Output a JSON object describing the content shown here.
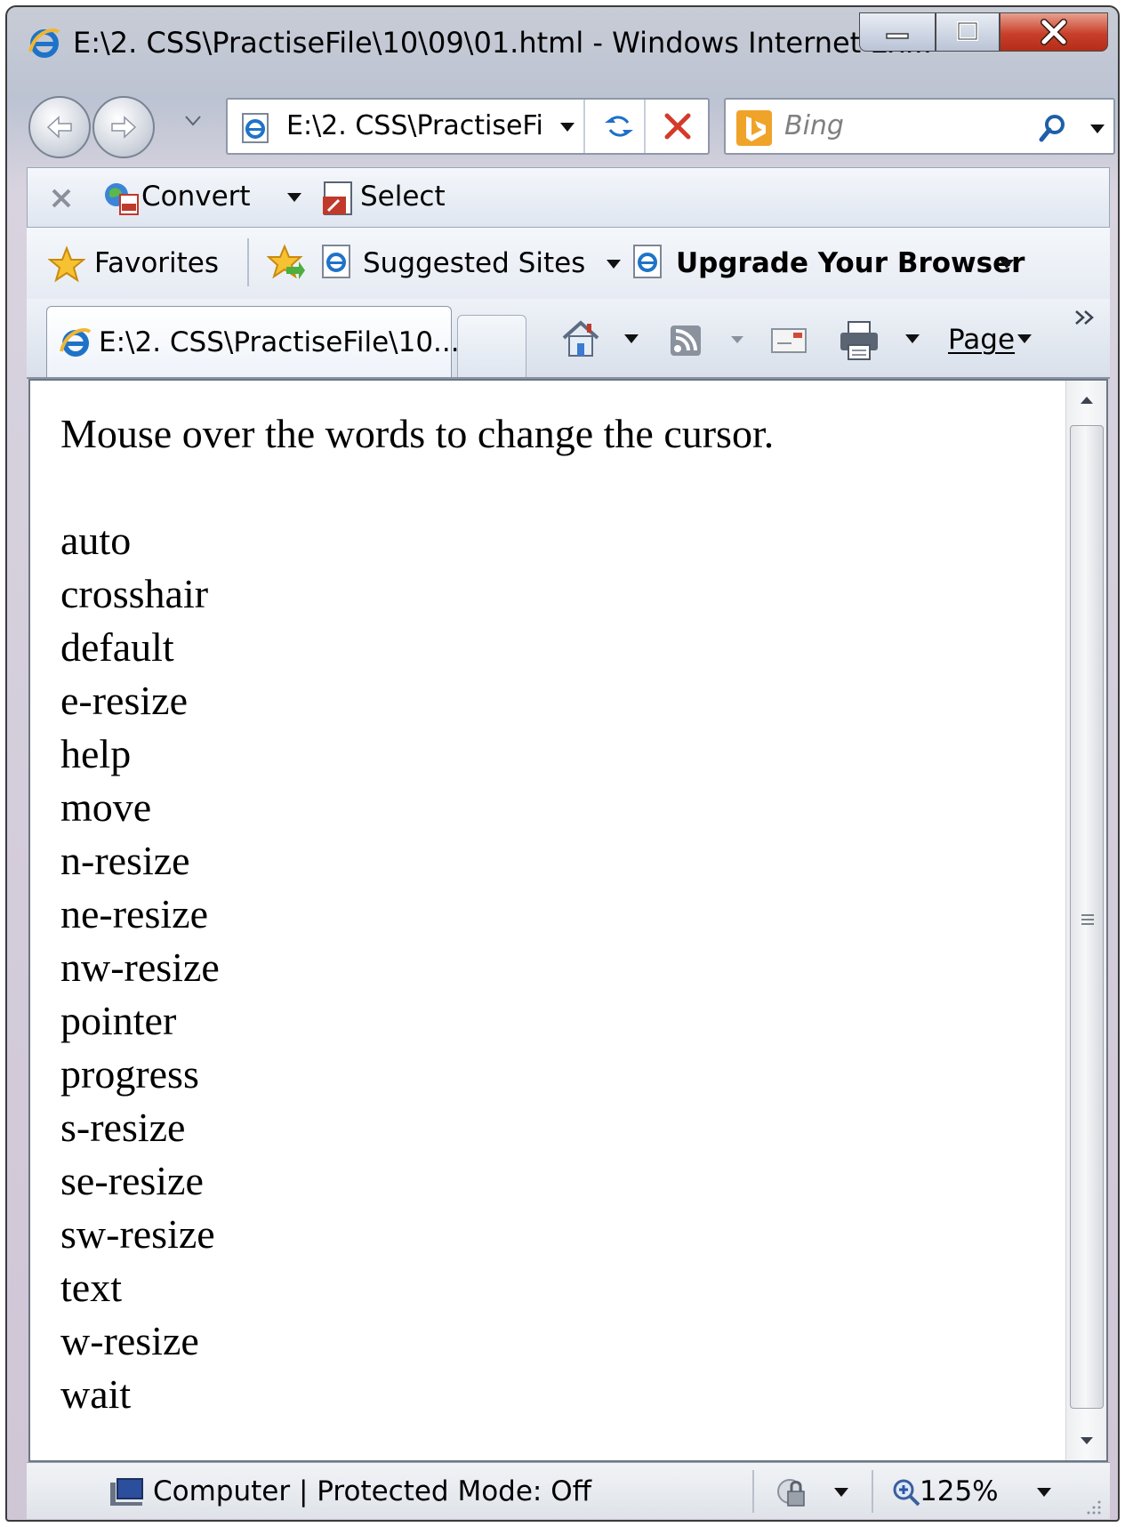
{
  "window": {
    "title": "E:\\2. CSS\\PractiseFile\\10\\09\\01.html - Windows Internet Ex..."
  },
  "address_bar": {
    "url": "E:\\2. CSS\\PractiseFi"
  },
  "search": {
    "placeholder": "Bing"
  },
  "convert_toolbar": {
    "convert_label": "Convert",
    "select_label": "Select"
  },
  "favorites_bar": {
    "favorites_label": "Favorites",
    "suggested_sites_label": "Suggested Sites",
    "upgrade_label": "Upgrade Your Browser"
  },
  "tabs": [
    {
      "label": "E:\\2. CSS\\PractiseFile\\10..."
    }
  ],
  "command_bar": {
    "page_label": "Page"
  },
  "content": {
    "intro": "Mouse over the words to change the cursor.",
    "cursors": [
      "auto",
      "crosshair",
      "default",
      "e-resize",
      "help",
      "move",
      "n-resize",
      "ne-resize",
      "nw-resize",
      "pointer",
      "progress",
      "s-resize",
      "se-resize",
      "sw-resize",
      "text",
      "w-resize",
      "wait"
    ]
  },
  "status_bar": {
    "zone_text": "Computer | Protected Mode: Off",
    "zoom_text": "125%"
  }
}
